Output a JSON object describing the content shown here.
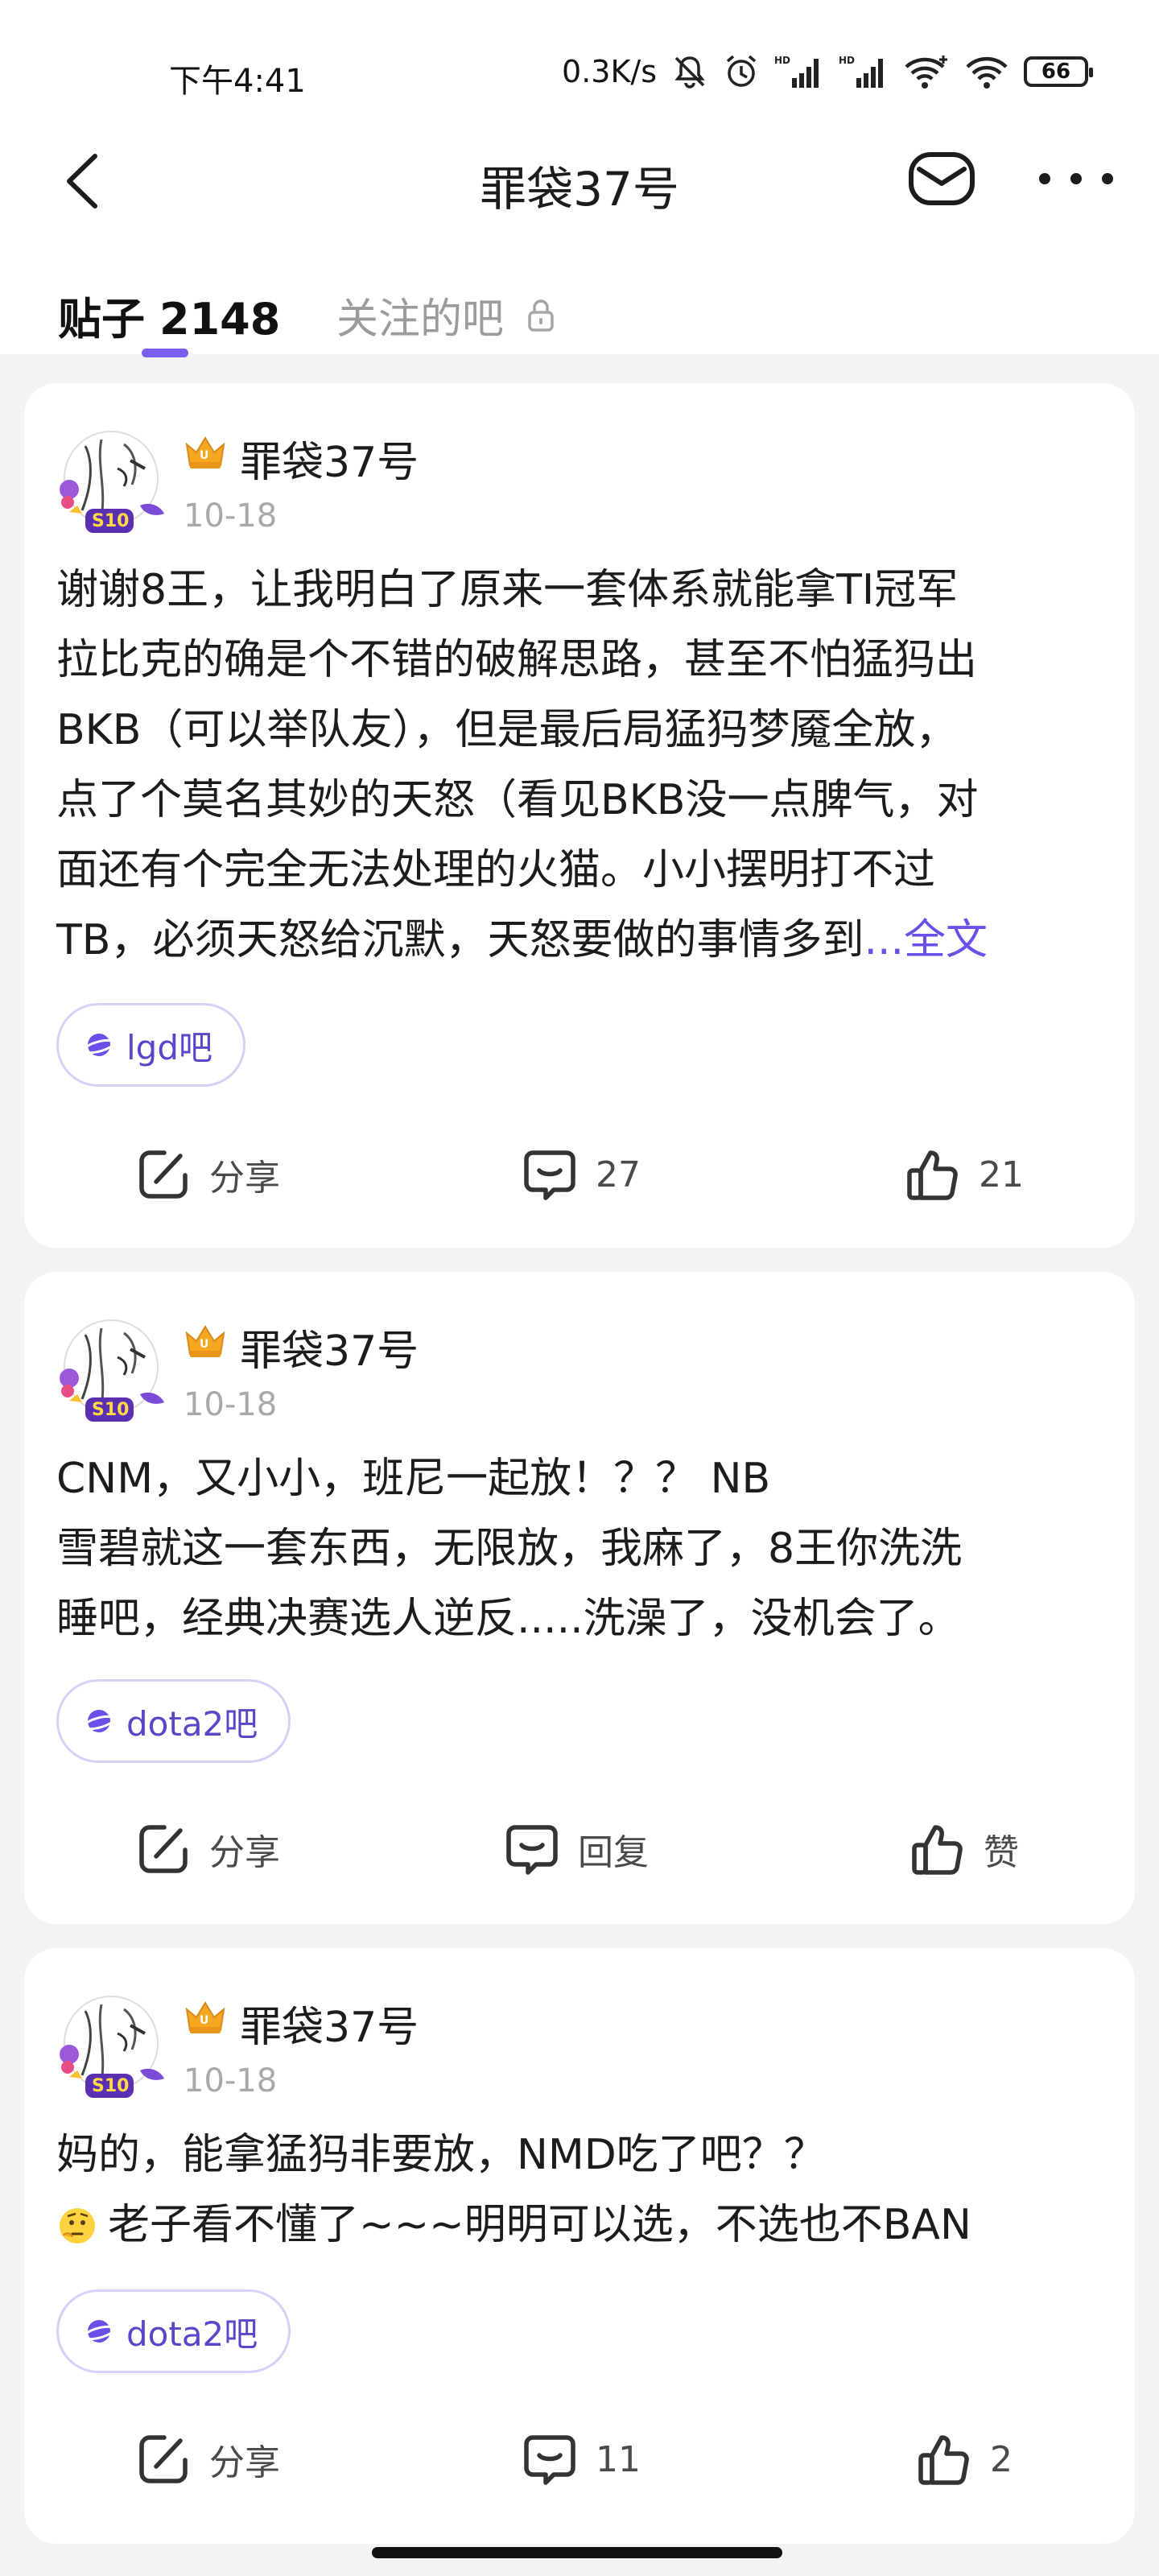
{
  "status_bar": {
    "time": "下午4:41",
    "net_speed": "0.3K/s",
    "battery": "66"
  },
  "header": {
    "title": "罪袋37号"
  },
  "tabs": {
    "posts_label": "贴子",
    "posts_count": "2148",
    "follow_label": "关注的吧"
  },
  "posts": [
    {
      "author": "罪袋37号",
      "date": "10-18",
      "text": "谢谢8王，让我明白了原来一套体系就能拿TI冠军\n拉比克的确是个不错的破解思路，甚至不怕猛犸出\nBKB（可以举队友），但是最后局猛犸梦魇全放，\n点了个莫名其妙的天怒（看见BKB没一点脾气，对\n面还有个完全无法处理的火猫。小小摆明打不过\nTB，必须天怒给沉默，天怒要做的事情多到",
      "ellipsis": "...",
      "more": "全文",
      "forum": "lgd吧",
      "share": "分享",
      "comments": "27",
      "likes": "21"
    },
    {
      "author": "罪袋37号",
      "date": "10-18",
      "text": "CNM，又小小，班尼一起放！？？ NB\n雪碧就这一套东西，无限放，我麻了，8王你洗洗\n睡吧，经典决赛选人逆反.....洗澡了，没机会了。",
      "forum": "dota2吧",
      "share": "分享",
      "comments": "回复",
      "likes": "赞"
    },
    {
      "author": "罪袋37号",
      "date": "10-18",
      "text_line1": "妈的，能拿猛犸非要放，NMD吃了吧？？",
      "text_line2": "老子看不懂了~~~明明可以选，不选也不BAN",
      "forum": "dota2吧",
      "share": "分享",
      "comments": "11",
      "likes": "2"
    }
  ],
  "colors": {
    "accent": "#6b4fe8",
    "background": "#f3f3f5",
    "card": "#ffffff",
    "meta_gray": "#a8a8a8"
  }
}
